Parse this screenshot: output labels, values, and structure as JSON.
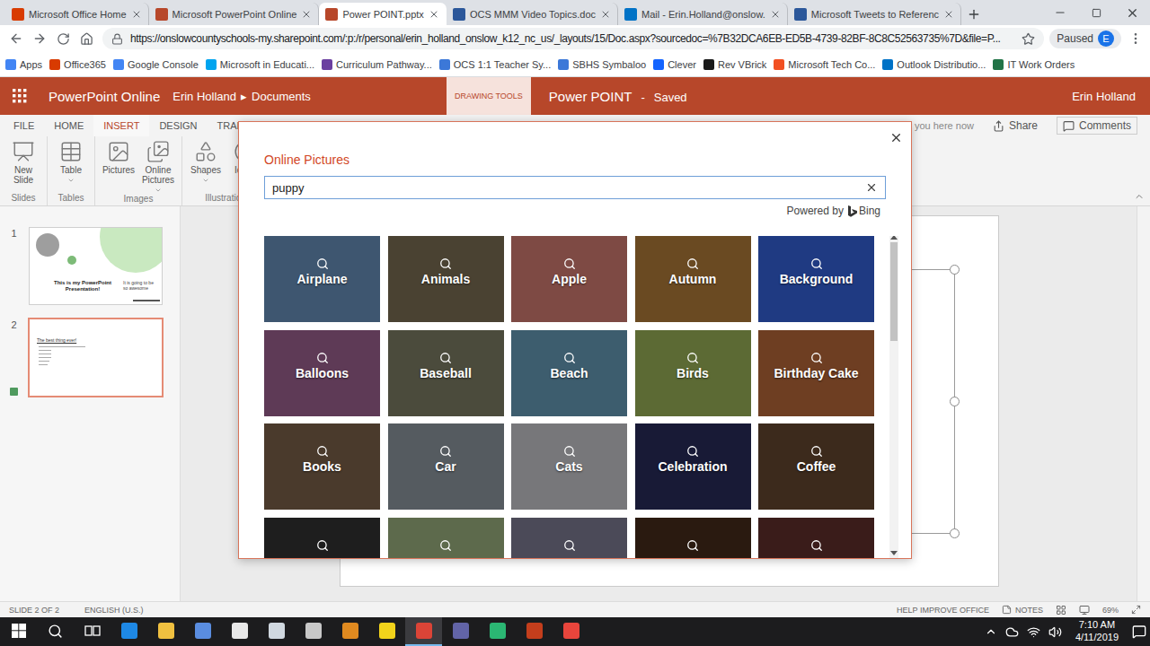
{
  "browser": {
    "tabs": [
      {
        "title": "Microsoft Office Home",
        "selected": false,
        "color": "#d83b01"
      },
      {
        "title": "Microsoft PowerPoint Online",
        "selected": false,
        "color": "#b7472a"
      },
      {
        "title": "Power POINT.pptx",
        "selected": true,
        "color": "#b7472a"
      },
      {
        "title": "OCS MMM Video Topics.doc",
        "selected": false,
        "color": "#2b579a"
      },
      {
        "title": "Mail - Erin.Holland@onslow.",
        "selected": false,
        "color": "#0072c6"
      },
      {
        "title": "Microsoft Tweets to Referenc",
        "selected": false,
        "color": "#2b579a"
      }
    ],
    "url": "https://onslowcountyschools-my.sharepoint.com/:p:/r/personal/erin_holland_onslow_k12_nc_us/_layouts/15/Doc.aspx?sourcedoc=%7B32DCA6EB-ED5B-4739-82BF-8C8C52563735%7D&file=P...",
    "profile": {
      "label": "Paused",
      "initial": "E"
    },
    "bookmarks": [
      {
        "label": "Apps",
        "color": "#4285f4"
      },
      {
        "label": "Office365",
        "color": "#d83b01"
      },
      {
        "label": "Google Console",
        "color": "#4285f4"
      },
      {
        "label": "Microsoft in Educati...",
        "color": "#00a4ef"
      },
      {
        "label": "Curriculum Pathway...",
        "color": "#6b3fa0"
      },
      {
        "label": "OCS 1:1 Teacher Sy...",
        "color": "#3c78d8"
      },
      {
        "label": "SBHS Symbaloo",
        "color": "#3c78d8"
      },
      {
        "label": "Clever",
        "color": "#1464ff"
      },
      {
        "label": "Rev VBrick",
        "color": "#1a1a1a"
      },
      {
        "label": "Microsoft Tech Co...",
        "color": "#f25022"
      },
      {
        "label": "Outlook Distributio...",
        "color": "#0072c6"
      },
      {
        "label": "IT Work Orders",
        "color": "#217346"
      }
    ]
  },
  "app": {
    "name": "PowerPoint Online",
    "breadcrumb": [
      "Erin Holland",
      "Documents"
    ],
    "breadcrumb_separator": "▸",
    "context_tab": "DRAWING TOOLS",
    "document": "Power POINT",
    "title_separator": "-",
    "save_status": "Saved",
    "user": "Erin Holland"
  },
  "ribbon": {
    "tabs": [
      {
        "label": "FILE",
        "selected": false
      },
      {
        "label": "HOME",
        "selected": false
      },
      {
        "label": "INSERT",
        "selected": true
      },
      {
        "label": "DESIGN",
        "selected": false
      },
      {
        "label": "TRANS",
        "selected": false
      }
    ],
    "presence": "just you here now",
    "share": "Share",
    "comments": "Comments",
    "groups": [
      {
        "label": "Slides",
        "buttons": [
          {
            "label": "New Slide",
            "kind": "new-slide",
            "dropdown": false
          }
        ]
      },
      {
        "label": "Tables",
        "buttons": [
          {
            "label": "Table",
            "kind": "table",
            "dropdown": true
          }
        ]
      },
      {
        "label": "Images",
        "buttons": [
          {
            "label": "Pictures",
            "kind": "pictures",
            "dropdown": false
          },
          {
            "label": "Online Pictures",
            "kind": "online-pictures",
            "dropdown": true
          }
        ]
      },
      {
        "label": "Illustration",
        "buttons": [
          {
            "label": "Shapes",
            "kind": "shapes",
            "dropdown": true
          },
          {
            "label": "Icons",
            "kind": "icons",
            "dropdown": false
          }
        ]
      }
    ]
  },
  "slides": [
    {
      "number": "1",
      "selected": false,
      "kind": "title-slide",
      "marker": false,
      "title": "This is my PowerPoint Presentation!",
      "subtitle": "It is going to be so awesome"
    },
    {
      "number": "2",
      "selected": true,
      "kind": "bullet-slide",
      "marker": true,
      "title": "The best thing ever!"
    }
  ],
  "dialog": {
    "title": "Online Pictures",
    "query": "puppy",
    "powered_by": "Powered by",
    "brand": "Bing",
    "tiles": [
      {
        "label": "Airplane",
        "color": "#3e5670"
      },
      {
        "label": "Animals",
        "color": "#4a4232"
      },
      {
        "label": "Apple",
        "color": "#7e4a44"
      },
      {
        "label": "Autumn",
        "color": "#6a4a22"
      },
      {
        "label": "Background",
        "color": "#1f3a82"
      },
      {
        "label": "Balloons",
        "color": "#5e3a56"
      },
      {
        "label": "Baseball",
        "color": "#4b4b3c"
      },
      {
        "label": "Beach",
        "color": "#3d5d6e"
      },
      {
        "label": "Birds",
        "color": "#5c6a34"
      },
      {
        "label": "Birthday Cake",
        "color": "#6e3e22"
      },
      {
        "label": "Books",
        "color": "#4a3a2c"
      },
      {
        "label": "Car",
        "color": "#555b60"
      },
      {
        "label": "Cats",
        "color": "#77777a"
      },
      {
        "label": "Celebration",
        "color": "#181a36"
      },
      {
        "label": "Coffee",
        "color": "#3c2a1c"
      },
      {
        "color": "#1e1e1e"
      },
      {
        "color": "#5d6a4c"
      },
      {
        "color": "#4b4a58"
      },
      {
        "color": "#2a1a10"
      },
      {
        "color": "#3a1c1a"
      }
    ]
  },
  "status_bar": {
    "slide": "SLIDE 2 OF 2",
    "language": "ENGLISH (U.S.)",
    "help": "HELP IMPROVE OFFICE",
    "notes": "NOTES",
    "zoom": "69%"
  },
  "taskbar": {
    "apps": [
      {
        "kind": "start",
        "selected": false,
        "color": "#ffffff"
      },
      {
        "kind": "search",
        "selected": false,
        "color": "#ffffff"
      },
      {
        "kind": "taskview",
        "selected": false,
        "color": "#ffffff"
      },
      {
        "kind": "app",
        "selected": false,
        "color": "#1e88e5"
      },
      {
        "kind": "app",
        "selected": false,
        "color": "#f0c040"
      },
      {
        "kind": "app",
        "selected": false,
        "color": "#5a8de0"
      },
      {
        "kind": "app",
        "selected": false,
        "color": "#e8e8e8"
      },
      {
        "kind": "app",
        "selected": false,
        "color": "#d0d8e0"
      },
      {
        "kind": "app",
        "selected": false,
        "color": "#c8c8c8"
      },
      {
        "kind": "app",
        "selected": false,
        "color": "#e08a20"
      },
      {
        "kind": "app",
        "selected": false,
        "color": "#f2d31b"
      },
      {
        "kind": "app",
        "selected": true,
        "color": "#db4437"
      },
      {
        "kind": "app",
        "selected": false,
        "color": "#6264a7"
      },
      {
        "kind": "app",
        "selected": false,
        "color": "#2bb673"
      },
      {
        "kind": "app",
        "selected": false,
        "color": "#c43e1c"
      },
      {
        "kind": "app",
        "selected": false,
        "color": "#e8453c"
      }
    ],
    "time": "7:10 AM",
    "date": "4/11/2019"
  }
}
